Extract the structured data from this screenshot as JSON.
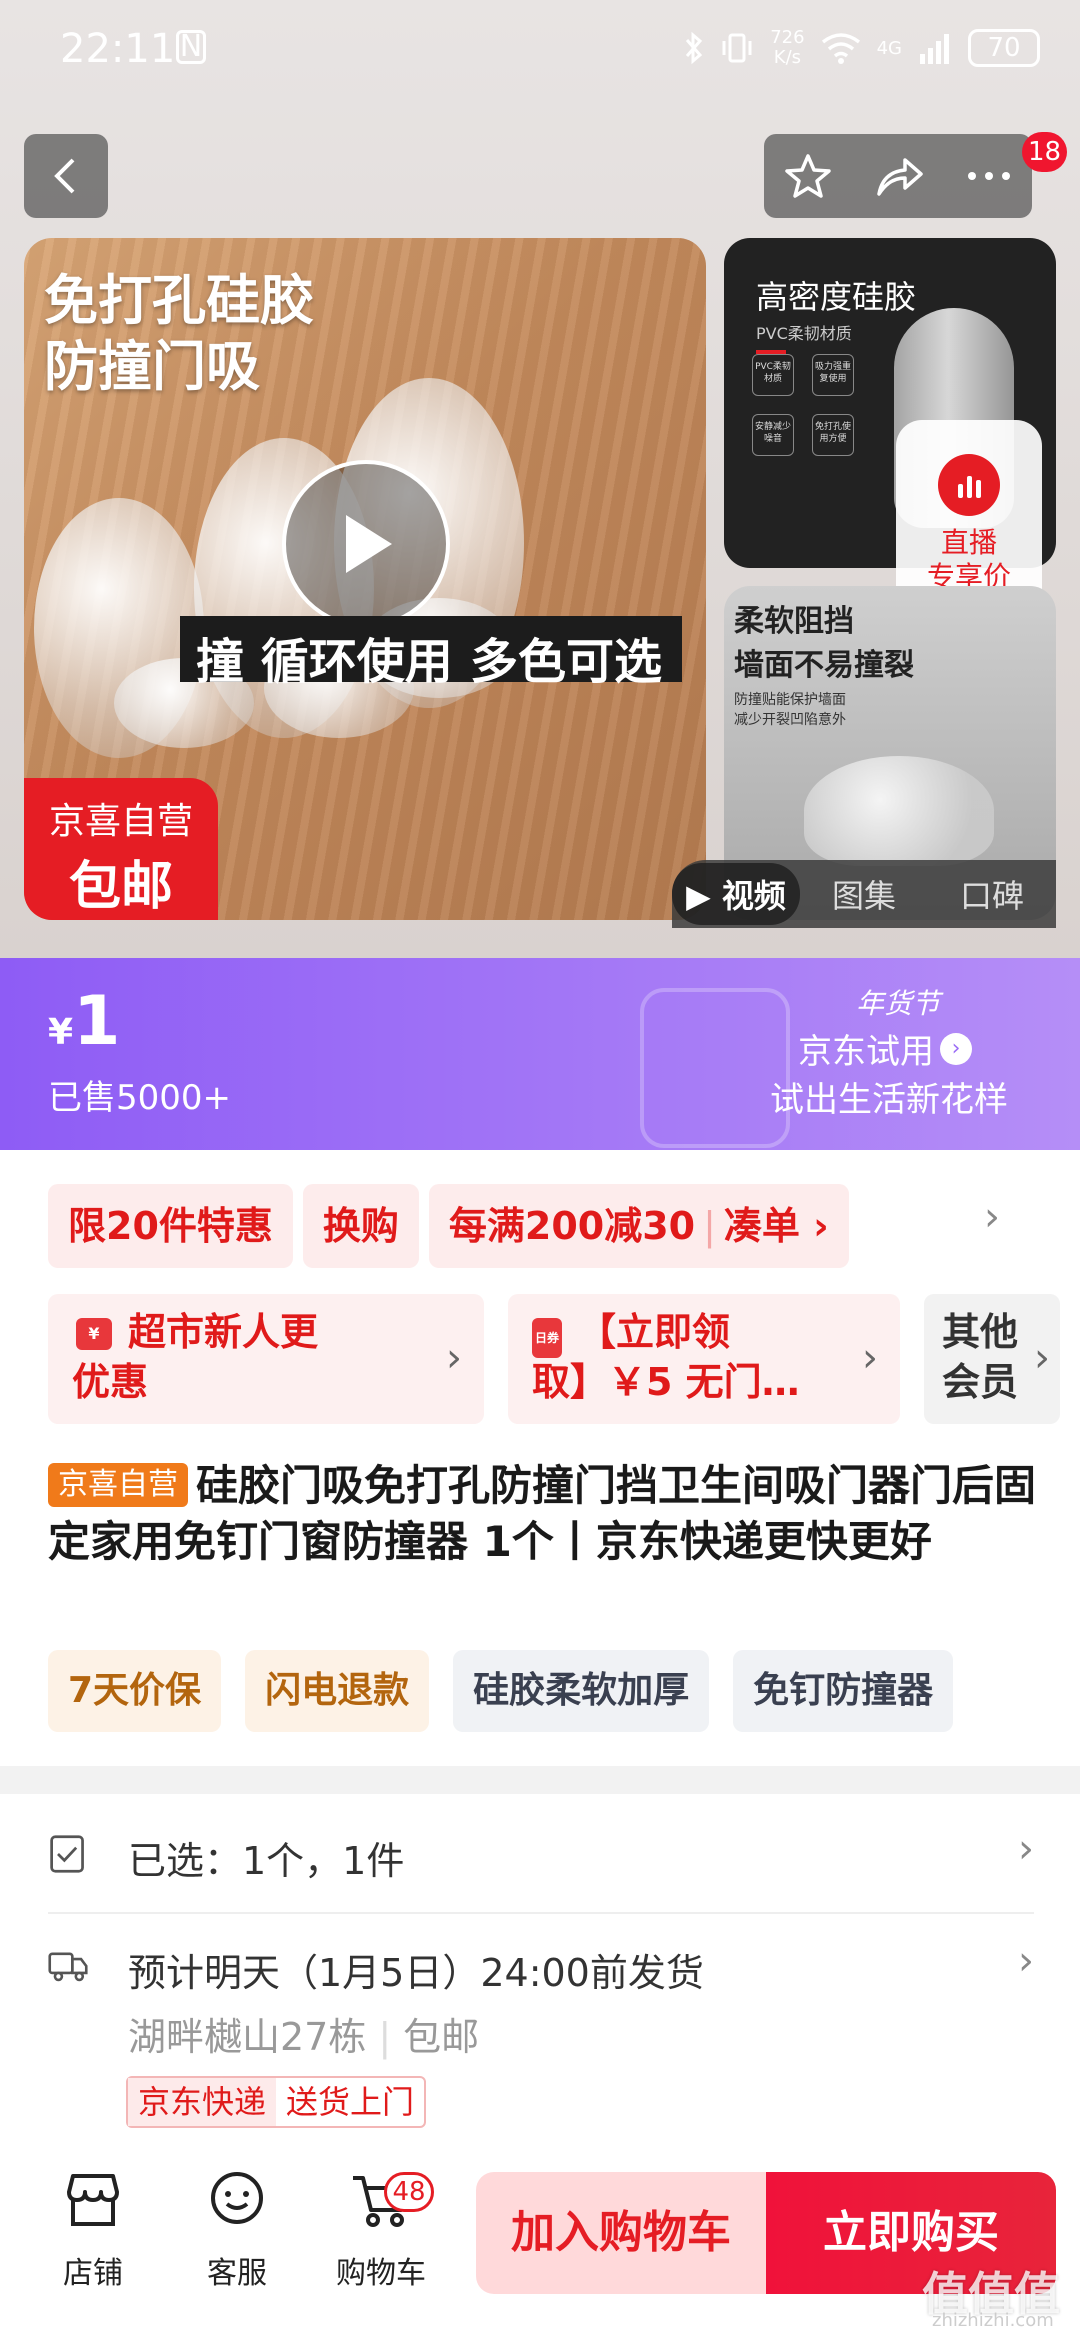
{
  "status_bar": {
    "time": "22:11",
    "nfc": "N",
    "net_speed_top": "726",
    "net_speed_bottom": "K/s",
    "network": "4G",
    "battery": "70"
  },
  "header": {
    "message_badge": "18"
  },
  "gallery": {
    "main_headline_line1": "免打孔硅胶",
    "main_headline_line2": "防撞门吸",
    "strip_text_1": "撞 循环使用",
    "strip_text_2": "多色可选",
    "badge_line1": "京喜自营",
    "badge_line2": "包邮",
    "thumb1_title": "高密度硅胶",
    "thumb1_sub": "PVC柔韧材质",
    "thumb1_chips": [
      "PVC柔韧材质",
      "吸力强重复使用",
      "安静减少噪音",
      "免打孔使用方便"
    ],
    "thumb2_title_line1": "柔软阻挡",
    "thumb2_title_line2": "墙面不易撞裂",
    "thumb2_sub_line1": "防撞贴能保护墙面",
    "thumb2_sub_line2": "减少开裂凹陷意外",
    "live_label_line1": "直播",
    "live_label_line2": "专享价",
    "tabs": [
      "视频",
      "图集",
      "口碑"
    ],
    "active_tab": "视频"
  },
  "price_banner": {
    "currency": "¥",
    "price": "1",
    "sold": "已售5000+",
    "festival": "年货节",
    "trial": "京东试用",
    "trial_sub": "试出生活新花样",
    "colors": {
      "start": "#8e5cf5",
      "end": "#b58ef7"
    }
  },
  "promotions": {
    "chips": [
      "限20件特惠",
      "换购",
      "每满200减30"
    ],
    "combo": "凑单 ›"
  },
  "coupons": {
    "newcomer_line1": "超市新人更",
    "newcomer_line2": "优惠",
    "claim_line1": "【立即领",
    "claim_line2": "取】￥5 无门…",
    "member_line1": "其他",
    "member_line2": "会员"
  },
  "product": {
    "tag": "京喜自营",
    "title": "硅胶门吸免打孔防撞门挡卫生间吸门器门后固定家用免钉门窗防撞器 1个丨京东快递更快更好"
  },
  "services": {
    "warm": [
      "7天价保",
      "闪电退款"
    ],
    "cool": [
      "硅胶柔软加厚",
      "免钉防撞器"
    ]
  },
  "selection": {
    "selected": "已选：1个，1件",
    "delivery": "预计明天（1月5日）24:00前发货",
    "address": "湖畔樾山27栋",
    "shipping": "包邮",
    "tag1": "京东快递",
    "tag2": "送货上门"
  },
  "bottom_bar": {
    "store": "店铺",
    "service": "客服",
    "cart": "购物车",
    "cart_count": "48",
    "add_to_cart": "加入购物车",
    "buy_now": "立即购买",
    "accent": "#e51d24"
  },
  "watermark": {
    "main": "值值值",
    "sub": "zhizhizhi.com"
  }
}
